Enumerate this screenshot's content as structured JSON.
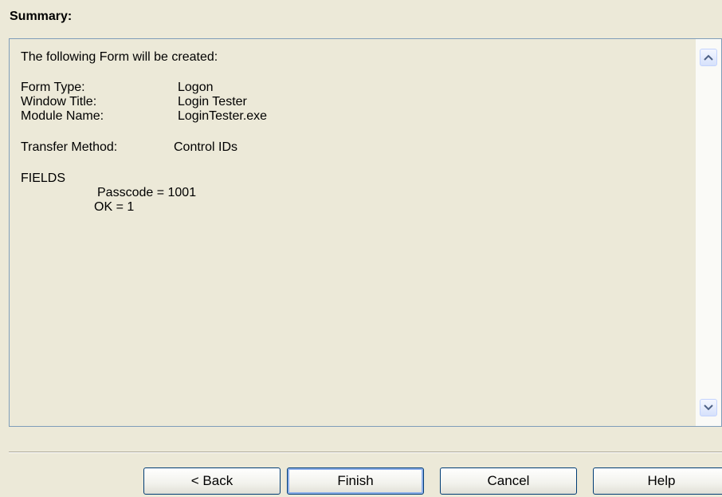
{
  "summary": {
    "heading": "Summary:",
    "intro": "The following Form will be created:",
    "fields": [
      {
        "label": "Form Type:",
        "value": "Logon"
      },
      {
        "label": "Window Title:",
        "value": "Login Tester"
      },
      {
        "label": "Module Name:",
        "value": "LoginTester.exe"
      }
    ],
    "transfer": {
      "label": "Transfer Method:",
      "value": "Control IDs"
    },
    "fields_heading": "FIELDS",
    "field_items": [
      "Passcode = 1001",
      "OK = 1"
    ]
  },
  "scrollbar": {
    "up_icon": "chevron-up-icon",
    "down_icon": "chevron-down-icon"
  },
  "buttons": {
    "back": "< Back",
    "finish": "Finish",
    "cancel": "Cancel",
    "help": "Help"
  },
  "colors": {
    "background": "#ece9d8",
    "box_border": "#7f9db9",
    "button_border": "#003c74"
  }
}
